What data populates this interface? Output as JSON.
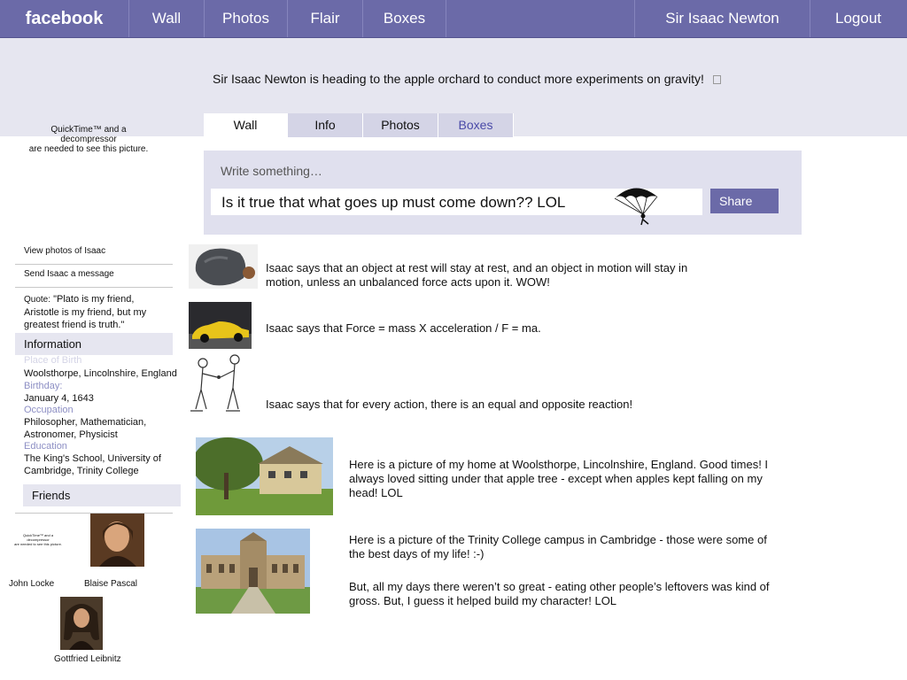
{
  "topbar": {
    "logo": "facebook",
    "nav": [
      "Wall",
      "Photos",
      "Flair",
      "Boxes"
    ],
    "user": "Sir Isaac Newton",
    "logout": "Logout"
  },
  "status": "Sir Isaac Newton is heading to the apple orchard to conduct more experiments on gravity!",
  "profile_placeholder": [
    "QuickTime™ and a",
    "decompressor",
    "are needed to see this picture."
  ],
  "tabs": [
    "Wall",
    "Info",
    "Photos",
    "Boxes"
  ],
  "write": {
    "label": "Write something…",
    "value": "Is it true that what goes up must come down??  LOL",
    "share": "Share"
  },
  "sidebar": {
    "view_photos": "View photos of Isaac",
    "send_message": "Send Isaac a message",
    "quote_label": "Quote:",
    "quote": "\"Plato is my friend, Aristotle is my friend, but my greatest friend is truth.\"",
    "information_title": "Information",
    "place_label": "Place of Birth",
    "place_value": "Woolsthorpe, Lincolnshire, England",
    "birthday_label": "Birthday:",
    "birthday_value": "January 4, 1643",
    "occupation_label": "Occupation",
    "occupation_value": "Philosopher, Mathematician, Astronomer, Physicist",
    "education_label": "Education",
    "education_value": "The King's School, University of Cambridge, Trinity College",
    "friends_title": "Friends",
    "friend_placeholder": [
      "QuickTime™ and a",
      "decompressor",
      "are needed to see this picture."
    ],
    "friends": [
      "John Locke",
      "Blaise Pascal",
      "Gottfried Leibnitz"
    ]
  },
  "feed": [
    "Isaac  says that an object at rest will stay at rest, and an object in motion will stay in motion, unless an unbalanced force acts upon it.  WOW!",
    "Isaac says that Force = mass X acceleration / F = ma.",
    "Isaac says that for every action, there is an equal and opposite reaction!",
    "Here is a picture of my home at Woolsthorpe, Lincolnshire, England.  Good times!  I always loved sitting under that apple tree - except when apples kept falling on my head!  LOL",
    "Here is a picture of the Trinity College campus in Cambridge - those were some of the best days of my life!  :-)",
    "But, all my days there weren’t so great - eating other people’s leftovers was kind of gross.  But, I guess it helped build my character!  LOL"
  ],
  "colors": {
    "brand": "#6b6aa8",
    "band": "#e6e6f0",
    "label": "#8d8fc4"
  }
}
